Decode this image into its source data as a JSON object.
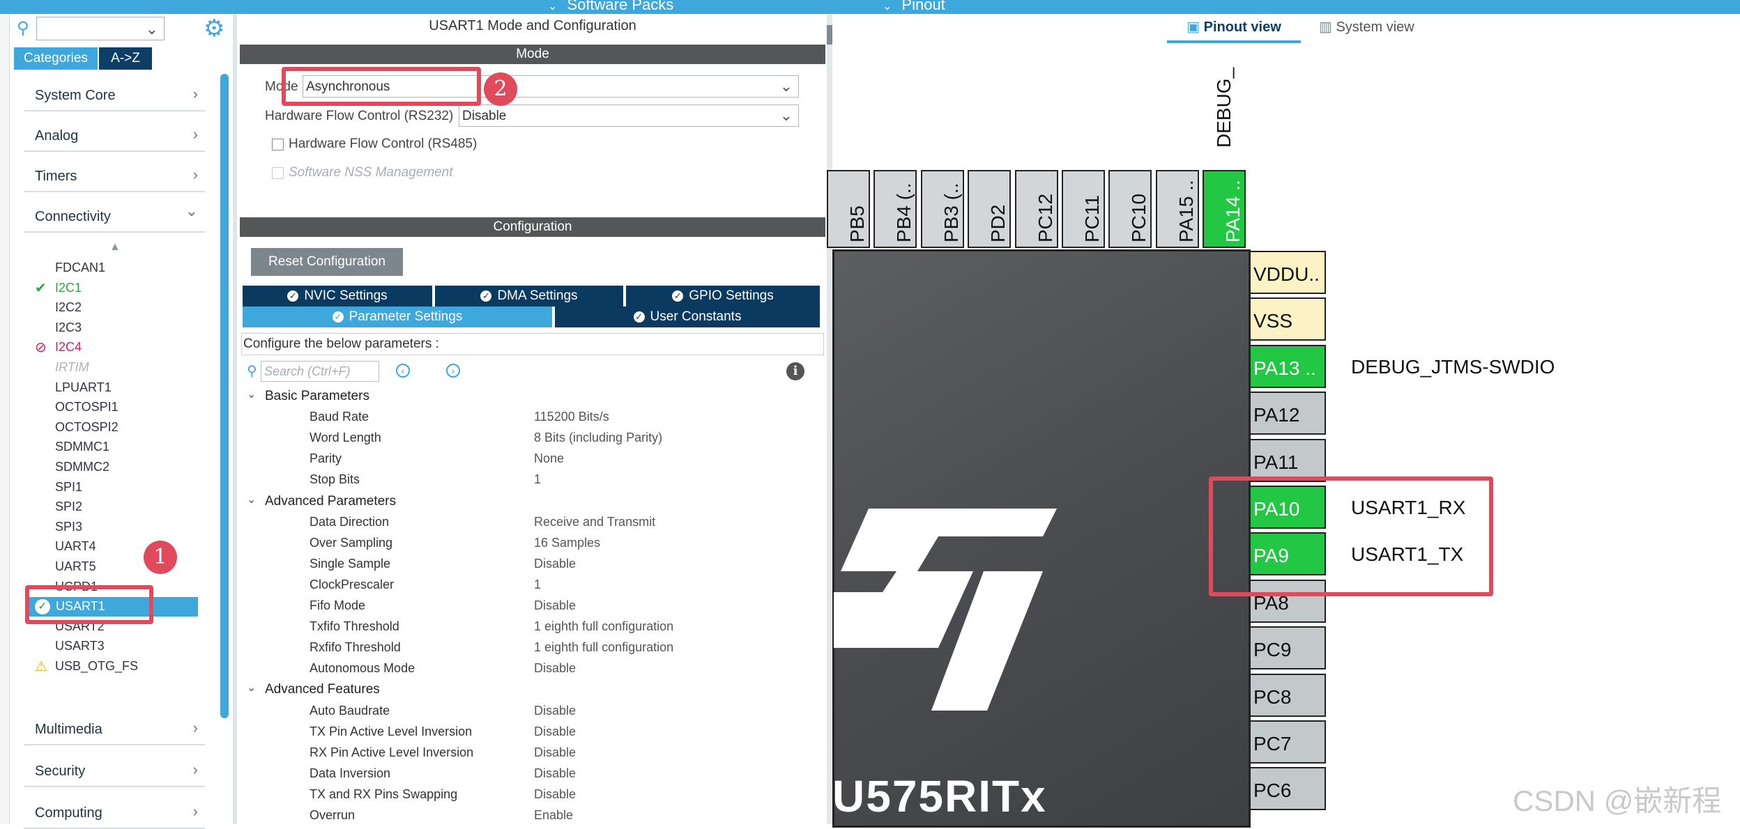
{
  "top_bar": {
    "software_packs": "Software Packs",
    "pinout": "Pinout"
  },
  "left_panel": {
    "tabs": {
      "categories": "Categories",
      "az": "A->Z"
    },
    "categories": [
      {
        "label": "System Core"
      },
      {
        "label": "Analog"
      },
      {
        "label": "Timers"
      },
      {
        "label": "Connectivity"
      },
      {
        "label": "Multimedia"
      },
      {
        "label": "Security"
      },
      {
        "label": "Computing"
      }
    ],
    "connectivity_items": [
      {
        "label": "FDCAN1",
        "status": "none"
      },
      {
        "label": "I2C1",
        "status": "ok"
      },
      {
        "label": "I2C2",
        "status": "none"
      },
      {
        "label": "I2C3",
        "status": "none"
      },
      {
        "label": "I2C4",
        "status": "disabled"
      },
      {
        "label": "IRTIM",
        "status": "unavailable"
      },
      {
        "label": "LPUART1",
        "status": "none"
      },
      {
        "label": "OCTOSPI1",
        "status": "none"
      },
      {
        "label": "OCTOSPI2",
        "status": "none"
      },
      {
        "label": "SDMMC1",
        "status": "none"
      },
      {
        "label": "SDMMC2",
        "status": "none"
      },
      {
        "label": "SPI1",
        "status": "none"
      },
      {
        "label": "SPI2",
        "status": "none"
      },
      {
        "label": "SPI3",
        "status": "none"
      },
      {
        "label": "UART4",
        "status": "none"
      },
      {
        "label": "UART5",
        "status": "none"
      },
      {
        "label": "UCPD1",
        "status": "none"
      },
      {
        "label": "USART1",
        "status": "selected"
      },
      {
        "label": "USART2",
        "status": "none"
      },
      {
        "label": "USART3",
        "status": "none"
      },
      {
        "label": "USB_OTG_FS",
        "status": "warning"
      }
    ]
  },
  "mode_panel": {
    "title": "USART1 Mode and Configuration",
    "mode_header": "Mode",
    "mode_label": "Mode",
    "mode_value": "Asynchronous",
    "hw_flow_label": "Hardware Flow Control (RS232)",
    "hw_flow_value": "Disable",
    "rs485_label": "Hardware Flow Control (RS485)",
    "nss_label": "Software NSS Management"
  },
  "config_panel": {
    "header": "Configuration",
    "reset_label": "Reset Configuration",
    "tabs": {
      "nvic": "NVIC Settings",
      "dma": "DMA Settings",
      "gpio": "GPIO Settings",
      "params": "Parameter Settings",
      "constants": "User Constants"
    },
    "hint": "Configure the below parameters :",
    "search_placeholder": "Search (Ctrl+F)",
    "groups": [
      {
        "name": "Basic Parameters",
        "params": [
          {
            "name": "Baud Rate",
            "value": "115200 Bits/s"
          },
          {
            "name": "Word Length",
            "value": "8 Bits (including Parity)"
          },
          {
            "name": "Parity",
            "value": "None"
          },
          {
            "name": "Stop Bits",
            "value": "1"
          }
        ]
      },
      {
        "name": "Advanced Parameters",
        "params": [
          {
            "name": "Data Direction",
            "value": "Receive and Transmit"
          },
          {
            "name": "Over Sampling",
            "value": "16 Samples"
          },
          {
            "name": "Single Sample",
            "value": "Disable"
          },
          {
            "name": "ClockPrescaler",
            "value": "1"
          },
          {
            "name": "Fifo Mode",
            "value": "Disable"
          },
          {
            "name": "Txfifo Threshold",
            "value": "1 eighth full configuration"
          },
          {
            "name": "Rxfifo Threshold",
            "value": "1 eighth full configuration"
          },
          {
            "name": "Autonomous Mode",
            "value": "Disable"
          }
        ]
      },
      {
        "name": "Advanced Features",
        "params": [
          {
            "name": "Auto Baudrate",
            "value": "Disable"
          },
          {
            "name": "TX Pin Active Level Inversion",
            "value": "Disable"
          },
          {
            "name": "RX Pin Active Level Inversion",
            "value": "Disable"
          },
          {
            "name": "Data Inversion",
            "value": "Disable"
          },
          {
            "name": "TX and RX Pins Swapping",
            "value": "Disable"
          },
          {
            "name": "Overrun",
            "value": "Enable"
          }
        ]
      }
    ]
  },
  "pinout": {
    "tabs": {
      "pinout_view": "Pinout view",
      "system_view": "System view"
    },
    "debug_label": "DEBUG_",
    "top_pins": [
      {
        "label": "PB5",
        "state": "default"
      },
      {
        "label": "PB4 (..",
        "state": "default"
      },
      {
        "label": "PB3 (..",
        "state": "default"
      },
      {
        "label": "PD2",
        "state": "default"
      },
      {
        "label": "PC12",
        "state": "default"
      },
      {
        "label": "PC11",
        "state": "default"
      },
      {
        "label": "PC10",
        "state": "default"
      },
      {
        "label": "PA15 ..",
        "state": "default"
      },
      {
        "label": "PA14 ..",
        "state": "assigned"
      }
    ],
    "right_pins": [
      {
        "label": "VDDU..",
        "state": "power",
        "signal": ""
      },
      {
        "label": "VSS",
        "state": "power",
        "signal": ""
      },
      {
        "label": "PA13 ..",
        "state": "assigned",
        "signal": "DEBUG_JTMS-SWDIO"
      },
      {
        "label": "PA12",
        "state": "default",
        "signal": ""
      },
      {
        "label": "PA11",
        "state": "default",
        "signal": ""
      },
      {
        "label": "PA10",
        "state": "assigned",
        "signal": "USART1_RX"
      },
      {
        "label": "PA9",
        "state": "assigned",
        "signal": "USART1_TX"
      },
      {
        "label": "PA8",
        "state": "default",
        "signal": ""
      },
      {
        "label": "PC9",
        "state": "default",
        "signal": ""
      },
      {
        "label": "PC8",
        "state": "default",
        "signal": ""
      },
      {
        "label": "PC7",
        "state": "default",
        "signal": ""
      },
      {
        "label": "PC6",
        "state": "default",
        "signal": ""
      }
    ],
    "chip_name": "U575RITx"
  },
  "annotations": {
    "badge1": "1",
    "badge2": "2"
  },
  "watermark": "CSDN @嵌新程",
  "colors": {
    "accent": "#3ea7dc",
    "navy": "#0b3a60",
    "pin_green": "#22c844",
    "annotation_red": "#e04a5a"
  }
}
